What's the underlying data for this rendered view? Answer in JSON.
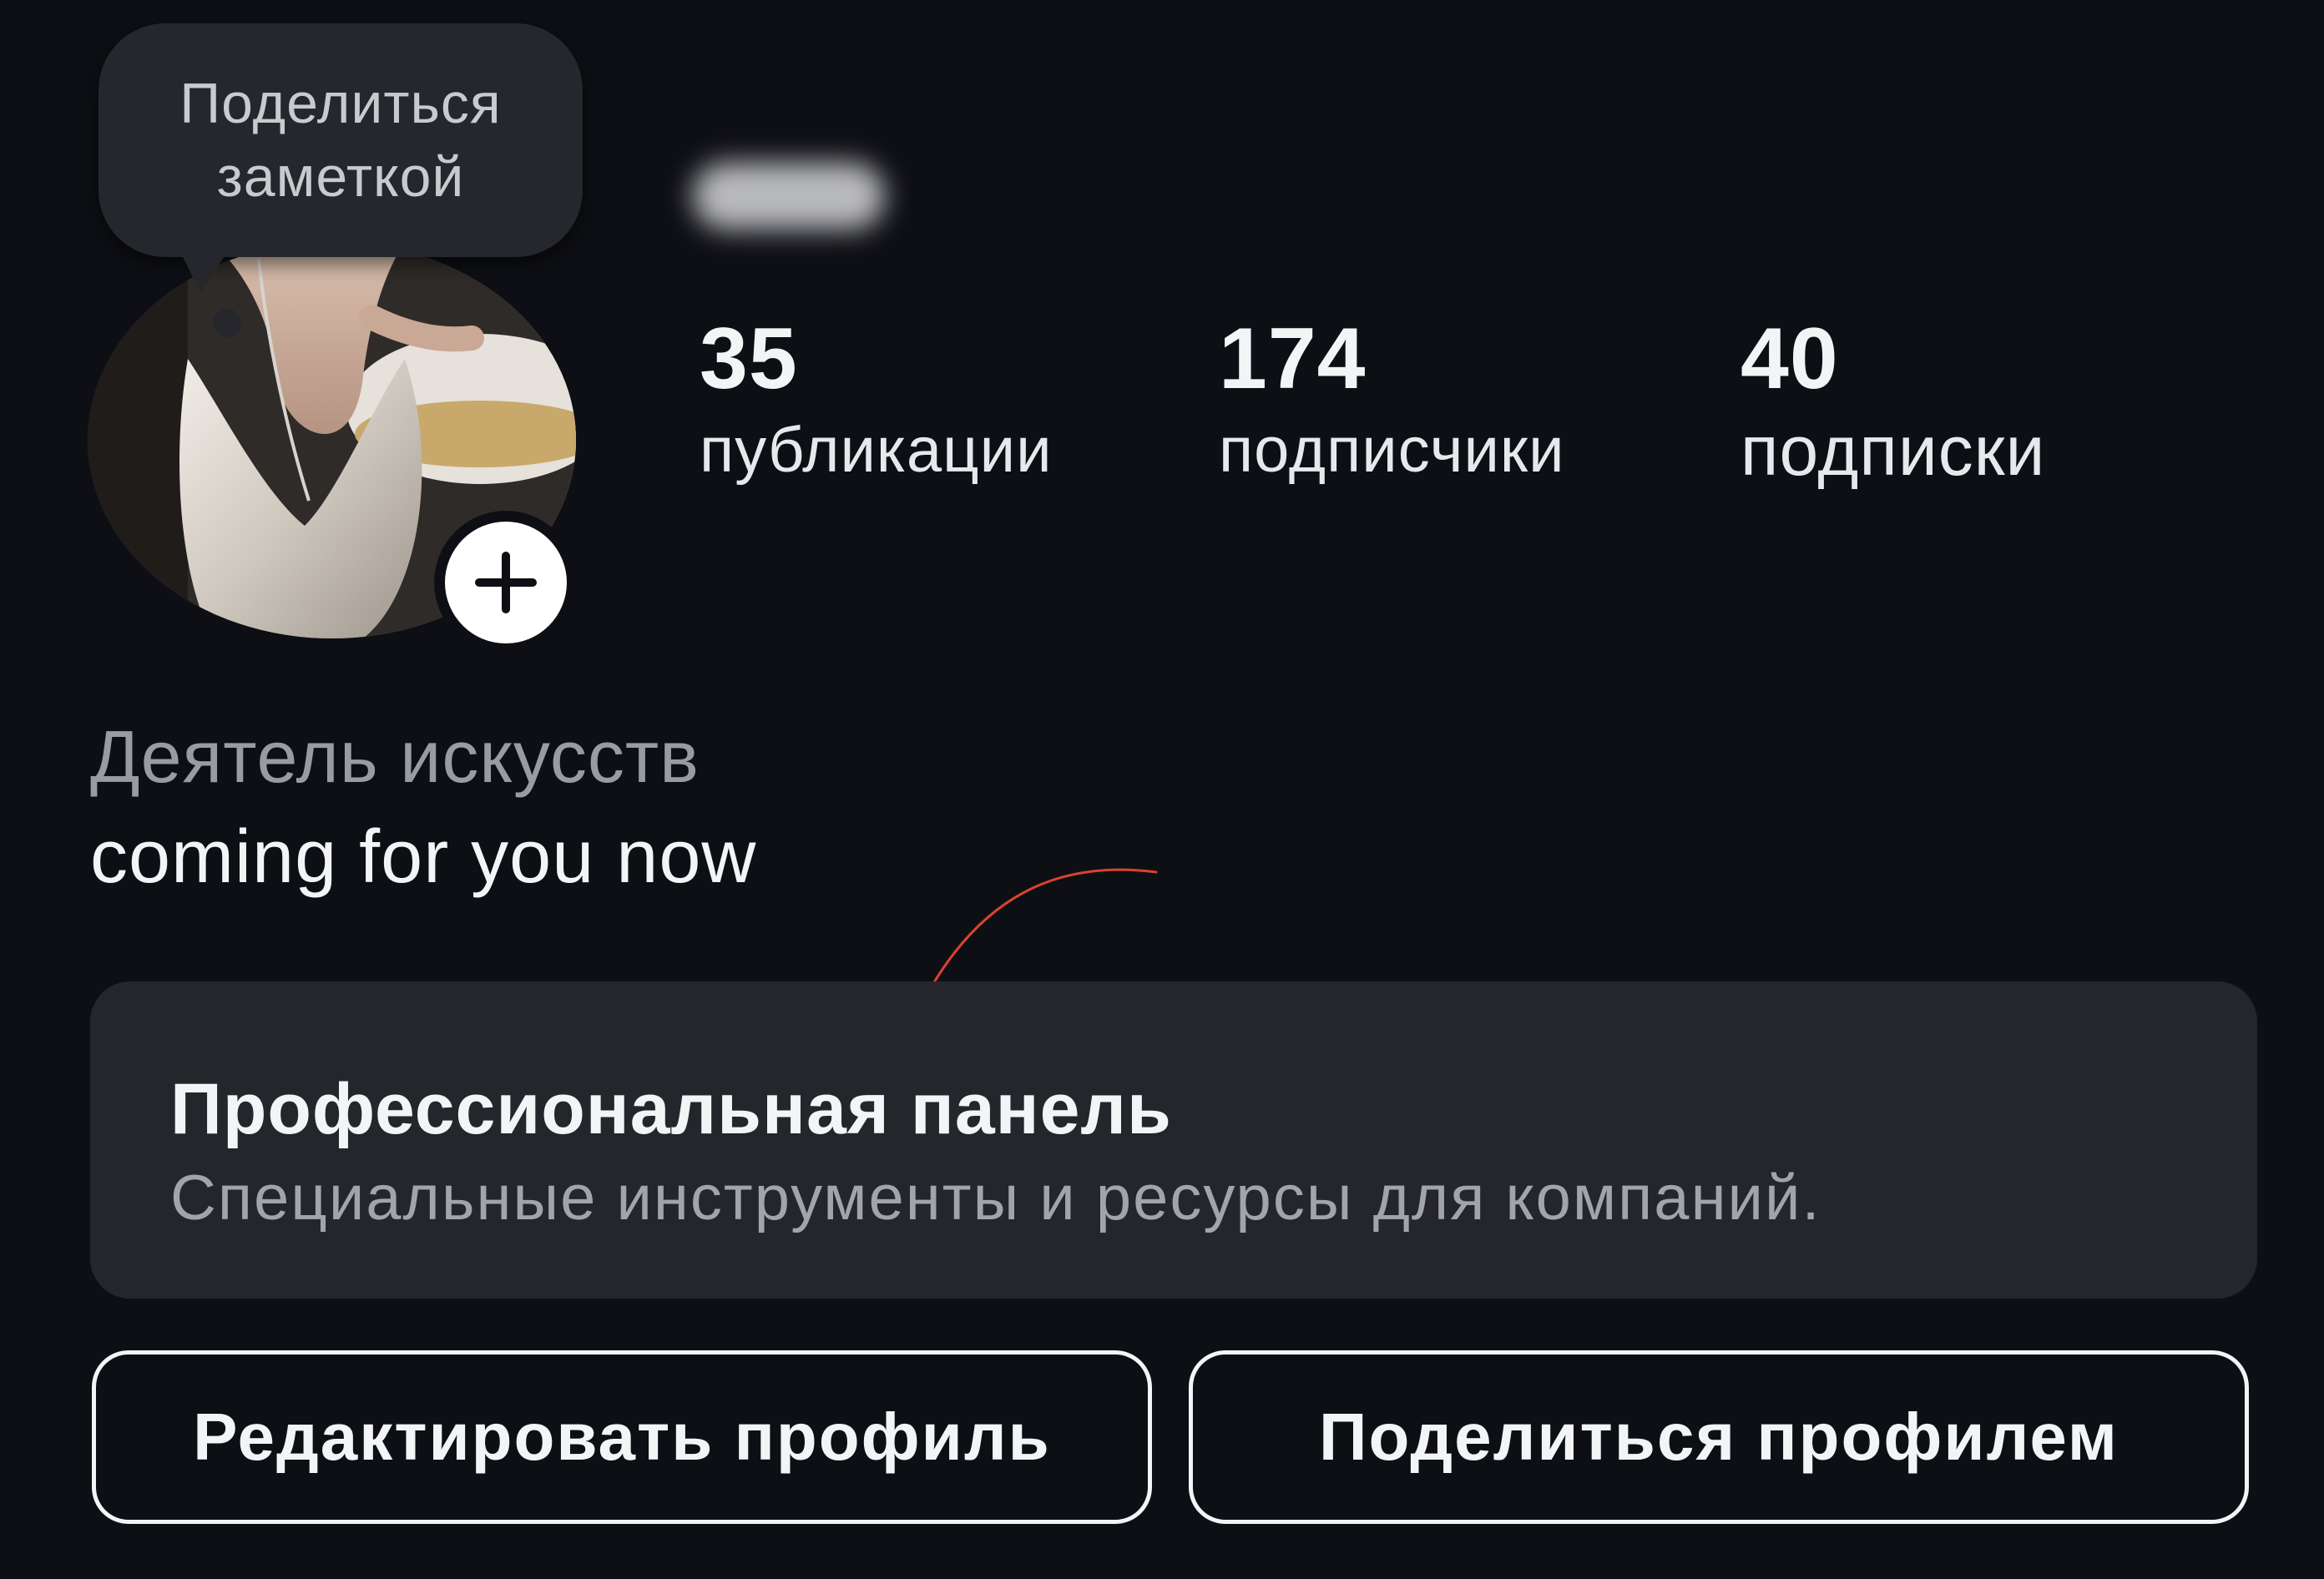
{
  "note": {
    "text": "Поделиться заметкой"
  },
  "profile": {
    "username": ""
  },
  "stats": [
    {
      "value": "35",
      "label": "публикации"
    },
    {
      "value": "174",
      "label": "подписчики"
    },
    {
      "value": "40",
      "label": "подписки"
    }
  ],
  "bio": {
    "category": "Деятель искусств",
    "text": "coming for you now"
  },
  "pro_dashboard": {
    "title": "Профессиональная панель",
    "subtitle": "Специальные инструменты и ресурсы для компаний."
  },
  "actions": {
    "edit_profile": "Редактировать профиль",
    "share_profile": "Поделиться профилем"
  },
  "colors": {
    "background": "#0e0f14",
    "card": "#25262c",
    "annotation_arrow": "#d9432f",
    "text_primary": "#f3f4f6",
    "text_secondary": "#9a9ba1"
  },
  "icons": {
    "add_story": "plus-icon",
    "annotation": "curved-arrow-icon"
  }
}
